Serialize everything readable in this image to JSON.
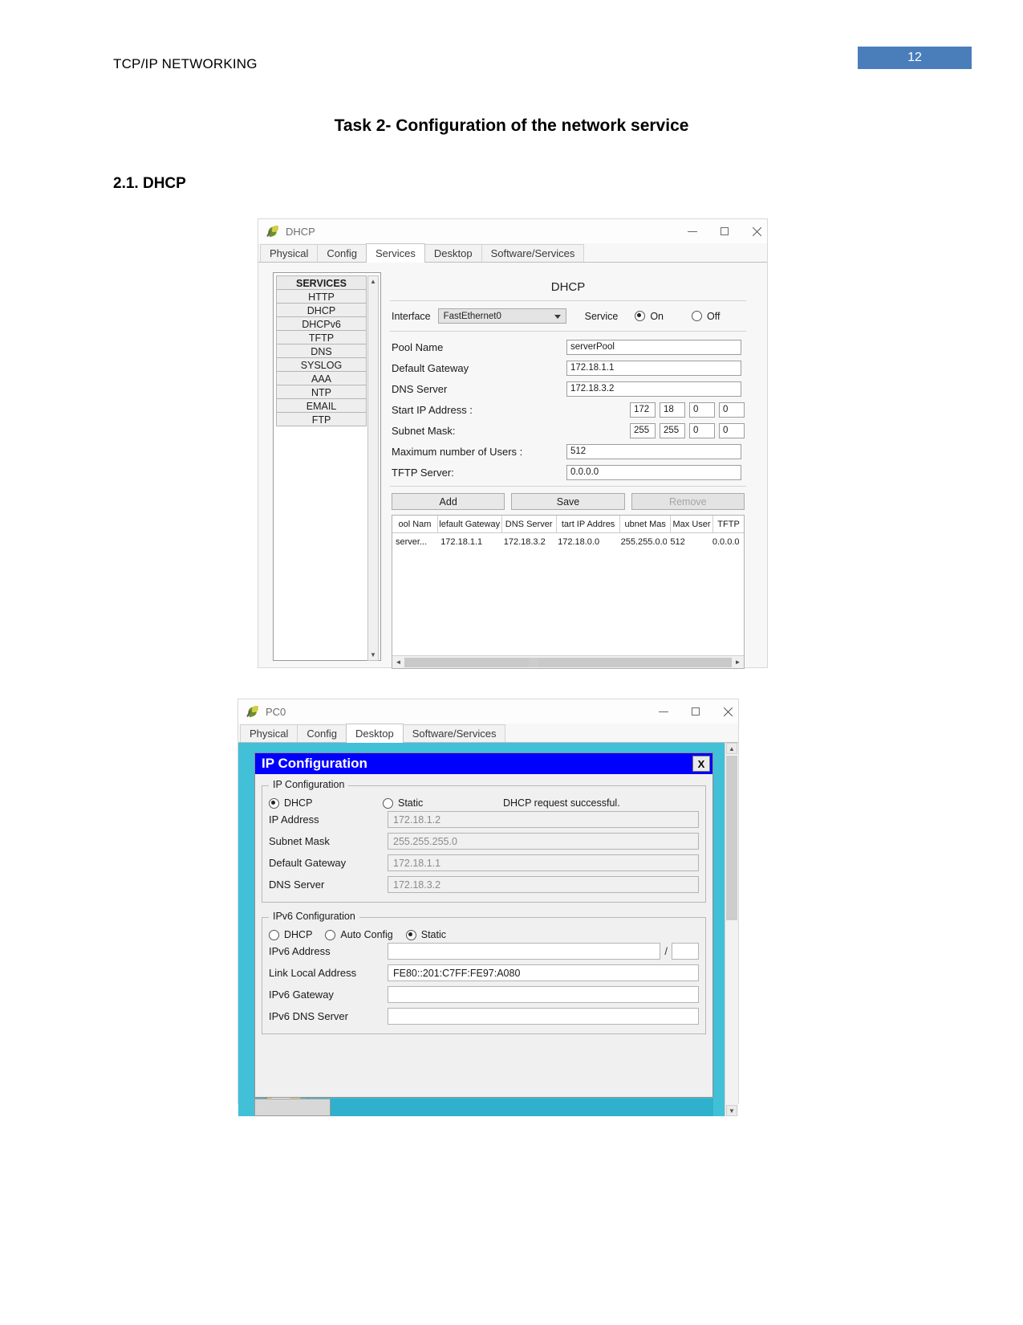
{
  "document": {
    "running_head": "TCP/IP NETWORKING",
    "page_number": "12",
    "task_title": "Task 2- Configuration of the network service",
    "section_title": "2.1. DHCP",
    "accent_color": "#4a7ebb"
  },
  "dhcp_window": {
    "title": "DHCP",
    "icon": "packet-tracer-device-icon",
    "window_buttons": {
      "minimize": "–",
      "maximize": "□",
      "close": "✕"
    },
    "tabs": [
      {
        "label": "Physical",
        "active": false
      },
      {
        "label": "Config",
        "active": false
      },
      {
        "label": "Services",
        "active": true
      },
      {
        "label": "Desktop",
        "active": false
      },
      {
        "label": "Software/Services",
        "active": false
      }
    ],
    "services_list": [
      {
        "label": "SERVICES",
        "header": true
      },
      {
        "label": "HTTP",
        "header": false
      },
      {
        "label": "DHCP",
        "header": false
      },
      {
        "label": "DHCPv6",
        "header": false
      },
      {
        "label": "TFTP",
        "header": false
      },
      {
        "label": "DNS",
        "header": false
      },
      {
        "label": "SYSLOG",
        "header": false
      },
      {
        "label": "AAA",
        "header": false
      },
      {
        "label": "NTP",
        "header": false
      },
      {
        "label": "EMAIL",
        "header": false
      },
      {
        "label": "FTP",
        "header": false
      }
    ],
    "panel_heading": "DHCP",
    "interface": {
      "label": "Interface",
      "value": "FastEthernet0",
      "service_label": "Service",
      "on_label": "On",
      "off_label": "Off",
      "selected": "On"
    },
    "fields": {
      "pool_name_label": "Pool Name",
      "pool_name_value": "serverPool",
      "default_gateway_label": "Default Gateway",
      "default_gateway_value": "172.18.1.1",
      "dns_server_label": "DNS Server",
      "dns_server_value": "172.18.3.2",
      "start_ip_label": "Start IP Address :",
      "start_ip_octets": [
        "172",
        "18",
        "0",
        "0"
      ],
      "subnet_mask_label": "Subnet Mask:",
      "subnet_mask_octets": [
        "255",
        "255",
        "0",
        "0"
      ],
      "max_users_label": "Maximum number of Users :",
      "max_users_value": "512",
      "tftp_server_label": "TFTP Server:",
      "tftp_server_value": "0.0.0.0"
    },
    "buttons": {
      "add": "Add",
      "save": "Save",
      "remove": "Remove"
    },
    "table": {
      "columns": [
        "ool Nam",
        "lefault Gateway",
        "DNS Server",
        "tart IP Addres",
        "ubnet Mas",
        "Max User",
        "TFTP"
      ],
      "rows": [
        [
          "server...",
          "172.18.1.1",
          "172.18.3.2",
          "172.18.0.0",
          "255.255.0.0",
          "512",
          "0.0.0.0"
        ]
      ]
    }
  },
  "pc_window": {
    "title": "PC0",
    "icon": "packet-tracer-device-icon",
    "window_buttons": {
      "minimize": "–",
      "maximize": "□",
      "close": "✕"
    },
    "tabs": [
      {
        "label": "Physical",
        "active": false
      },
      {
        "label": "Config",
        "active": false
      },
      {
        "label": "Desktop",
        "active": true
      },
      {
        "label": "Software/Services",
        "active": false
      }
    ],
    "ip_configuration": {
      "window_title": "IP Configuration",
      "close_button": "X",
      "ipv4": {
        "legend": "IP Configuration",
        "dhcp_label": "DHCP",
        "static_label": "Static",
        "selected": "DHCP",
        "status_message": "DHCP request successful.",
        "rows": [
          {
            "label": "IP Address",
            "value": "172.18.1.2"
          },
          {
            "label": "Subnet Mask",
            "value": "255.255.255.0"
          },
          {
            "label": "Default Gateway",
            "value": "172.18.1.1"
          },
          {
            "label": "DNS Server",
            "value": "172.18.3.2"
          }
        ]
      },
      "ipv6": {
        "legend": "IPv6 Configuration",
        "dhcp_label": "DHCP",
        "auto_config_label": "Auto Config",
        "static_label": "Static",
        "selected": "Static",
        "rows": [
          {
            "label": "IPv6 Address",
            "value": "",
            "has_prefix": true,
            "prefix": ""
          },
          {
            "label": "Link Local Address",
            "value": "FE80::201:C7FF:FE97:A080",
            "has_prefix": false
          },
          {
            "label": "IPv6 Gateway",
            "value": "",
            "has_prefix": false
          },
          {
            "label": "IPv6 DNS Server",
            "value": "",
            "has_prefix": false
          }
        ]
      }
    }
  }
}
